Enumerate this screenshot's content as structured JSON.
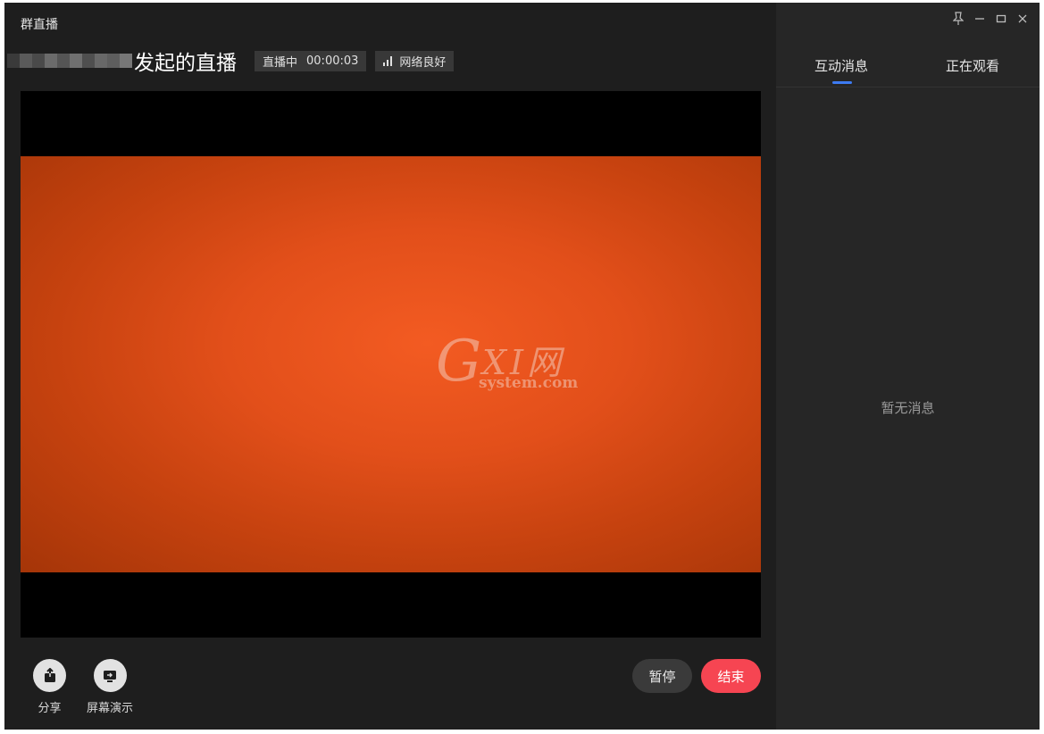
{
  "window": {
    "title": "群直播"
  },
  "header": {
    "host_title": "发起的直播",
    "live_status": "直播中",
    "timer": "00:00:03",
    "network_status": "网络良好",
    "mosaic_colors": [
      "#3a3a3a",
      "#5a5a5a",
      "#4a4a4a",
      "#6b6b6b",
      "#555555",
      "#707070",
      "#4f4f4f",
      "#686868",
      "#5e5e5e",
      "#777777"
    ]
  },
  "video": {
    "watermark_brand": "GXI网",
    "watermark_site": "system.com"
  },
  "toolbar": {
    "share_label": "分享",
    "screen_share_label": "屏幕演示",
    "pause_label": "暂停",
    "end_label": "结束"
  },
  "sidebar": {
    "tabs": [
      {
        "label": "互动消息",
        "active": true
      },
      {
        "label": "正在观看",
        "active": false
      }
    ],
    "empty_message": "暂无消息"
  },
  "colors": {
    "end_button": "#f64552",
    "tab_underline": "#3d7bf2",
    "video_orange": "#f35b22"
  },
  "icons": {
    "share": "share-icon",
    "screen_share": "screen-share-icon",
    "pin": "pin-icon",
    "minimize": "minimize-icon",
    "maximize": "maximize-icon",
    "close": "close-icon",
    "signal": "signal-bars-icon"
  }
}
